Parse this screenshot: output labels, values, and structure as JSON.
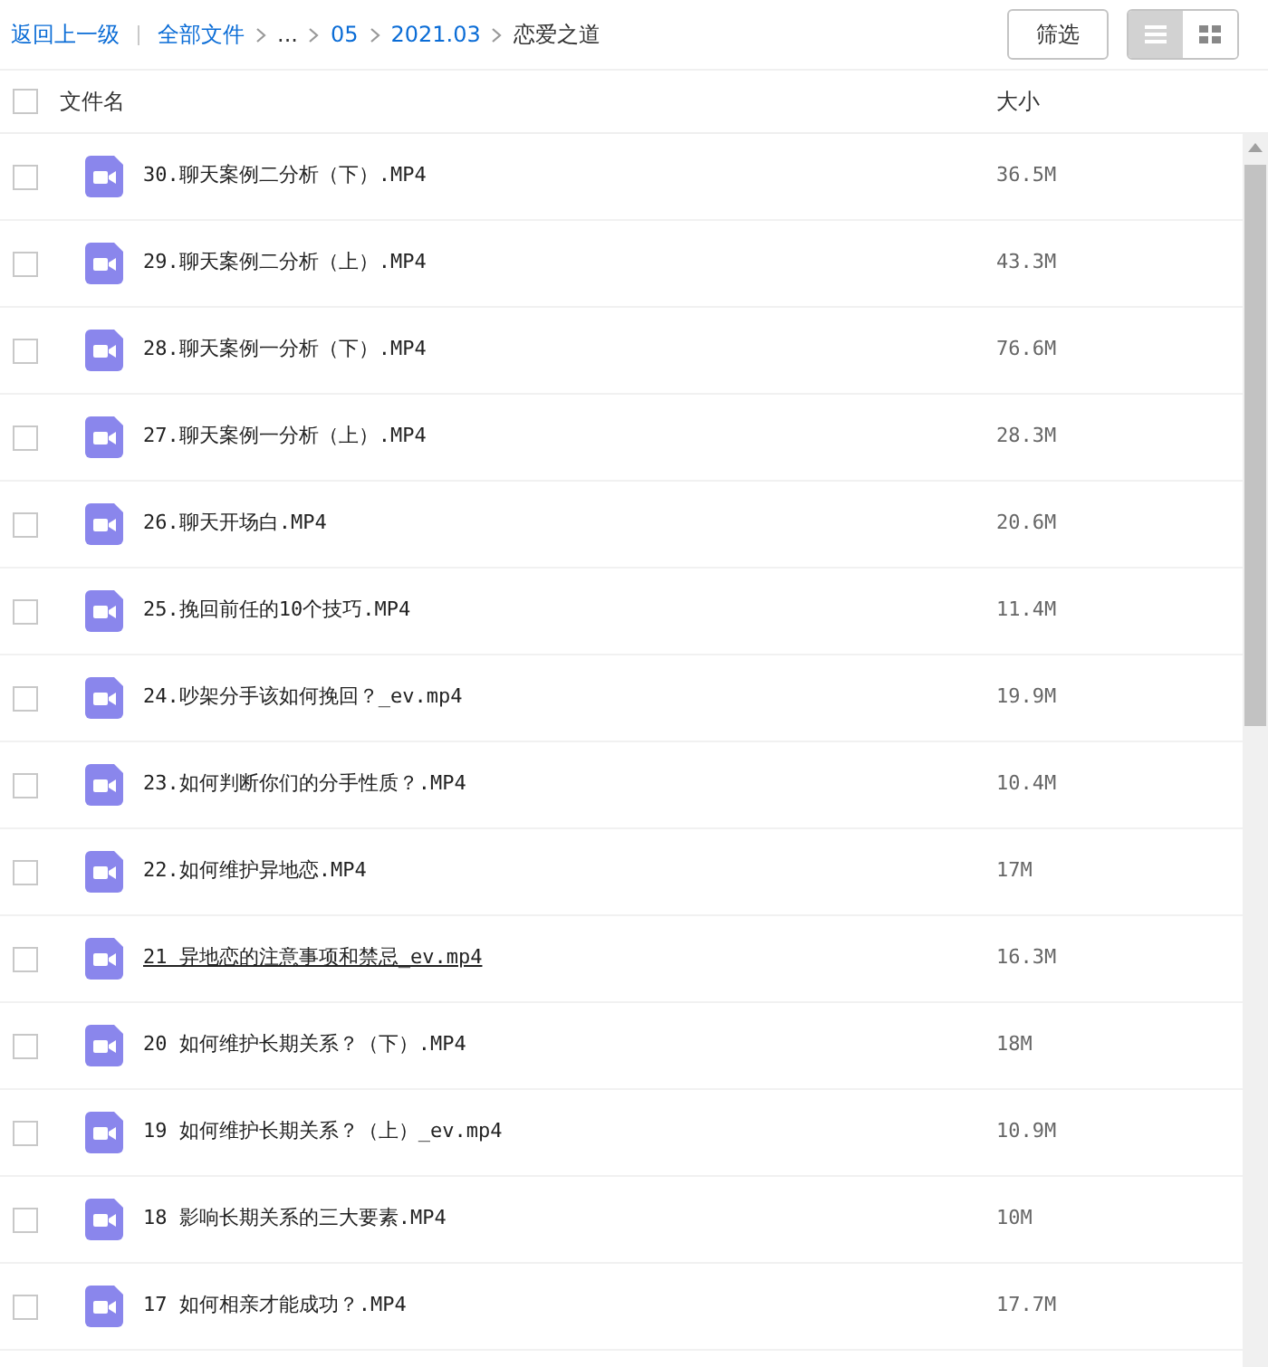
{
  "toolbar": {
    "back_link": "返回上一级",
    "breadcrumbs": [
      {
        "label": "全部文件",
        "kind": "link"
      },
      {
        "label": "...",
        "kind": "ellipsis"
      },
      {
        "label": "05",
        "kind": "link"
      },
      {
        "label": "2021.03",
        "kind": "link"
      },
      {
        "label": "恋爱之道",
        "kind": "current"
      }
    ],
    "filter_button": "筛选",
    "view_toggle": [
      {
        "kind": "list",
        "selected": true
      },
      {
        "kind": "grid",
        "selected": false
      }
    ]
  },
  "table": {
    "columns": [
      "文件名",
      "大小"
    ],
    "select_all_checked": false,
    "rows": [
      {
        "name": "30.聊天案例二分析（下）.MP4",
        "size": "36.5M",
        "checked": false,
        "hovered": false
      },
      {
        "name": "29.聊天案例二分析（上）.MP4",
        "size": "43.3M",
        "checked": false,
        "hovered": false
      },
      {
        "name": "28.聊天案例一分析（下）.MP4",
        "size": "76.6M",
        "checked": false,
        "hovered": false
      },
      {
        "name": "27.聊天案例一分析（上）.MP4",
        "size": "28.3M",
        "checked": false,
        "hovered": false
      },
      {
        "name": "26.聊天开场白.MP4",
        "size": "20.6M",
        "checked": false,
        "hovered": false
      },
      {
        "name": "25.挽回前任的10个技巧.MP4",
        "size": "11.4M",
        "checked": false,
        "hovered": false
      },
      {
        "name": "24.吵架分手该如何挽回？_ev.mp4",
        "size": "19.9M",
        "checked": false,
        "hovered": false
      },
      {
        "name": "23.如何判断你们的分手性质？.MP4",
        "size": "10.4M",
        "checked": false,
        "hovered": false
      },
      {
        "name": "22.如何维护异地恋.MP4",
        "size": "17M",
        "checked": false,
        "hovered": false
      },
      {
        "name": "21 异地恋的注意事项和禁忌_ev.mp4",
        "size": "16.3M",
        "checked": false,
        "hovered": true
      },
      {
        "name": "20 如何维护长期关系？（下）.MP4",
        "size": "18M",
        "checked": false,
        "hovered": false
      },
      {
        "name": "19 如何维护长期关系？（上）_ev.mp4",
        "size": "10.9M",
        "checked": false,
        "hovered": false
      },
      {
        "name": "18 影响长期关系的三大要素.MP4",
        "size": "10M",
        "checked": false,
        "hovered": false
      },
      {
        "name": "17 如何相亲才能成功？.MP4",
        "size": "17.7M",
        "checked": false,
        "hovered": false
      }
    ]
  }
}
